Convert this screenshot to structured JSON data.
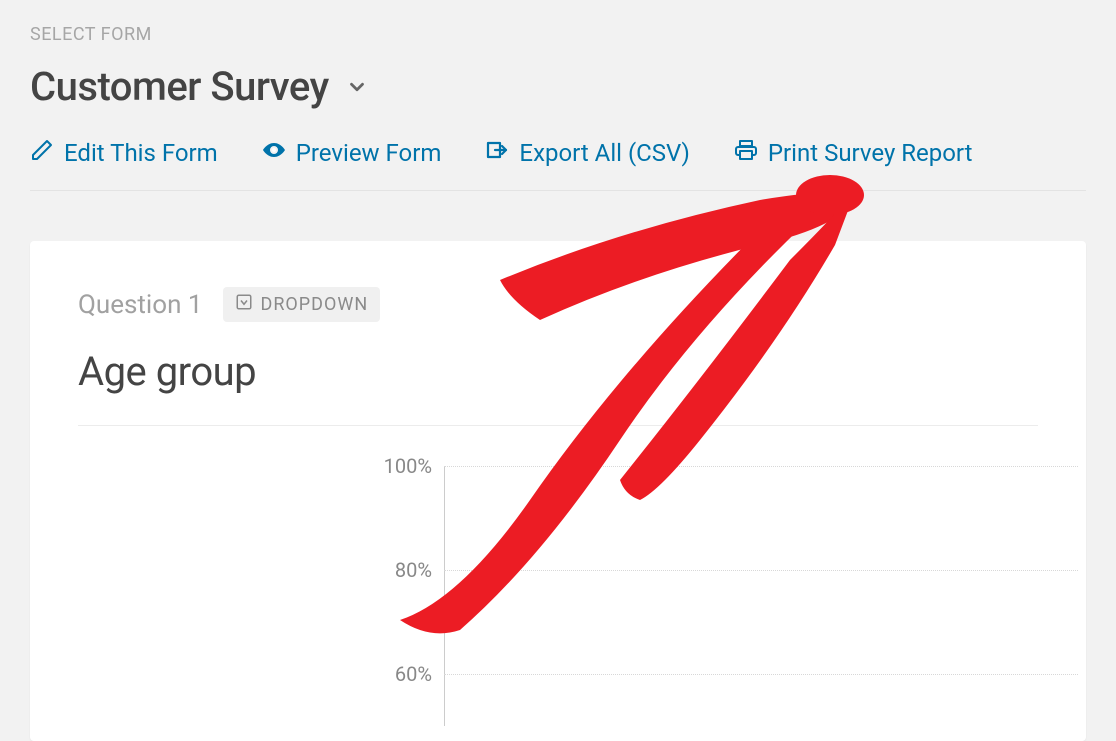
{
  "header": {
    "select_form_label": "SELECT FORM",
    "form_name": "Customer Survey"
  },
  "actions": {
    "edit": "Edit This Form",
    "preview": "Preview Form",
    "export": "Export All (CSV)",
    "print": "Print Survey Report"
  },
  "question": {
    "index_label": "Question 1",
    "type_label": "DROPDOWN",
    "title": "Age group"
  },
  "chart_data": {
    "type": "bar",
    "title": "Age group",
    "ylabel": "",
    "xlabel": "",
    "ylim": [
      0,
      100
    ],
    "y_ticks": [
      100,
      80,
      60
    ],
    "categories": [],
    "values": []
  }
}
